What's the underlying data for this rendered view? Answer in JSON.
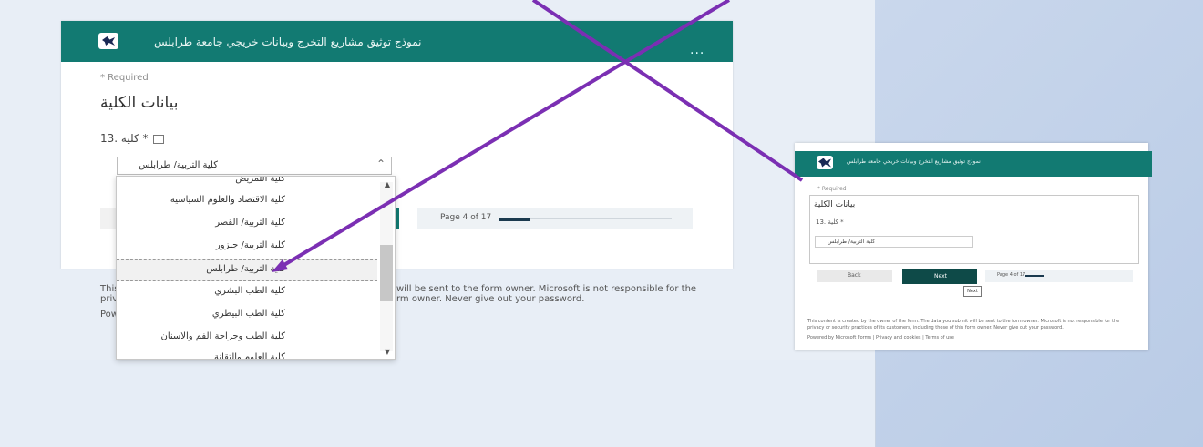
{
  "form": {
    "title": "نموذج توثيق مشاريع التخرج وبيانات خريجي جامعة طرابلس",
    "menu": "...",
    "required_note": "* Required",
    "section_title": "بيانات الكلية",
    "question_label": "13. كلية *",
    "selected_value": "كلية التربية/ طرابلس",
    "dropdown_options": [
      "كلية التمريض",
      "كلية الاقتصاد والعلوم السياسية",
      "كلية التربية/ القصر",
      "كلية التربية/ جنزور",
      "كلية التربية/ طرابلس",
      "كلية الطب البشري",
      "كلية الطب البيطري",
      "كلية الطب وجراحة الفم والاسنان",
      "كلية العلوم والتقانة"
    ],
    "progress_label": "Page 4 of 17",
    "progress_fraction": 0.18,
    "footer_line1_left": "This",
    "footer_line1_right": "will be sent to the form owner. Microsoft is not responsible for the",
    "footer_line2_left": "priv",
    "footer_line2_right": "rm owner. Never give out your password.",
    "footer_line3_left": "Pow"
  },
  "small_form": {
    "title": "نموذج توثيق مشاريع التخرج وبيانات خريجي جامعة طرابلس",
    "required_note": "* Required",
    "section_title": "بيانات الكلية",
    "question_label": "13. كلية *",
    "selected_value": "كلية التربية/ طرابلس",
    "back_label": "Back",
    "next_label": "Next",
    "tooltip": "Next",
    "progress_label": "Page 4 of 17",
    "footer_line1": "This content is created by the owner of the form. The data you submit will be sent to the form owner. Microsoft is not responsible for the",
    "footer_line2": "privacy or security practices of its customers, including those of this form owner. Never give out your password.",
    "footer_line3": "Powered by Microsoft Forms | Privacy and cookies | Terms of use"
  },
  "colors": {
    "header_teal": "#127a72",
    "next_dark": "#0e4a48",
    "cross_purple": "#7b2fb3"
  }
}
